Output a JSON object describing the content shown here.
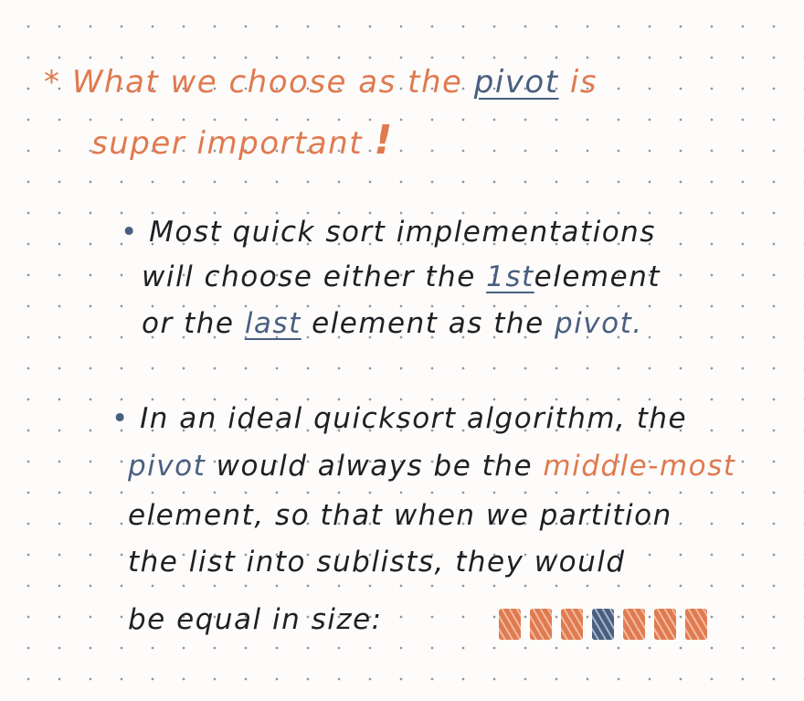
{
  "heading": {
    "star": "*",
    "line1_a": "What we choose as the",
    "line1_pivot": "pivot",
    "line1_b": "is",
    "line2": "super important",
    "exclaim": "!"
  },
  "bullet1": {
    "marker": "•",
    "l1": "Most quick sort implementations",
    "l2_a": "will choose either the",
    "l2_first": "1st",
    "l2_b": "element",
    "l3_a": "or the",
    "l3_last": "last",
    "l3_b": "element as the",
    "l3_pivot": "pivot."
  },
  "bullet2": {
    "marker": "•",
    "l1": "In an ideal quicksort algorithm, the",
    "l2_pivot": "pivot",
    "l2_a": "would always be the",
    "l2_middle": "middle-most",
    "l3": "element, so that when we partition",
    "l4": "the list into sublists, they would",
    "l5": "be equal in size:"
  },
  "diagram": {
    "boxes": [
      "element",
      "element",
      "element",
      "pivot",
      "element",
      "element",
      "element"
    ],
    "colors": {
      "element": "#e07a4f",
      "pivot": "#4a5f80"
    }
  }
}
